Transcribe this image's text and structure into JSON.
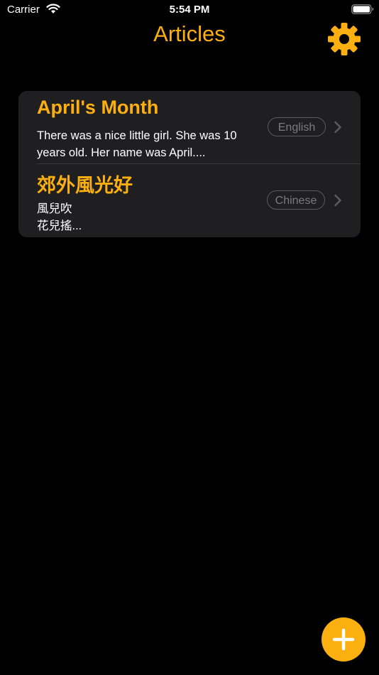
{
  "status_bar": {
    "carrier": "Carrier",
    "time": "5:54 PM"
  },
  "nav": {
    "title": "Articles",
    "settings_icon": "gear-icon"
  },
  "articles": [
    {
      "title": "April's Month",
      "excerpt": " There was a nice little girl. She was 10 years old. Her name was April....",
      "language": "English"
    },
    {
      "title": "郊外風光好",
      "excerpt": "風兒吹\n花兒搖...",
      "language": "Chinese"
    }
  ],
  "add_button_icon": "plus-icon",
  "colors": {
    "accent": "#fcaf10",
    "background": "#000000",
    "card": "#1f1f21"
  }
}
